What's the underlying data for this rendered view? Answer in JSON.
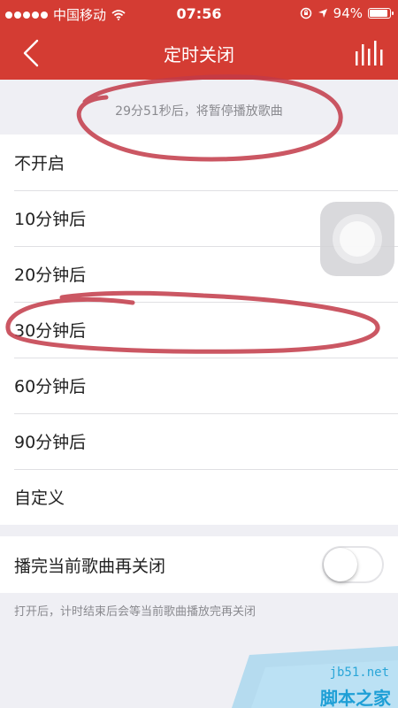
{
  "status_bar": {
    "carrier": "中国移动",
    "time": "07:56",
    "battery": "94%",
    "battery_level": 0.94,
    "icons": [
      "signal-dots-icon",
      "wifi-icon",
      "rotation-lock-icon",
      "location-arrow-icon",
      "battery-icon"
    ]
  },
  "nav": {
    "title": "定时关闭",
    "back_icon": "chevron-left-icon",
    "right_icon": "equalizer-icon"
  },
  "countdown_text": "29分51秒后，将暂停播放歌曲",
  "options": [
    {
      "label": "不开启"
    },
    {
      "label": "10分钟后"
    },
    {
      "label": "20分钟后"
    },
    {
      "label": "30分钟后"
    },
    {
      "label": "60分钟后"
    },
    {
      "label": "90分钟后"
    },
    {
      "label": "自定义"
    }
  ],
  "toggle": {
    "label": "播完当前歌曲再关闭",
    "state": "off",
    "note": "打开后，计时结束后会等当前歌曲播放完再关闭"
  },
  "watermark": {
    "url": "jb51.net",
    "name": "脚本之家"
  },
  "colors": {
    "brand_red": "#d43c33",
    "annotation_red": "#c23a48",
    "background": "#efeff4",
    "watermark_blue": "#1e9fd6"
  }
}
